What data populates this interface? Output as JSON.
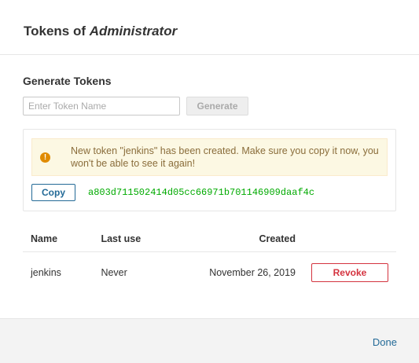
{
  "header": {
    "title_prefix": "Tokens of",
    "title_user": "Administrator"
  },
  "generate": {
    "section_title": "Generate Tokens",
    "input_placeholder": "Enter Token Name",
    "input_value": "",
    "button_label": "Generate"
  },
  "notice": {
    "message": "New token \"jenkins\" has been created. Make sure you copy it now, you won't be able to see it again!",
    "copy_label": "Copy",
    "token_value": "a803d711502414d05cc66971b701146909daaf4c",
    "alert_icon": "!"
  },
  "table": {
    "columns": {
      "name": "Name",
      "last_use": "Last use",
      "created": "Created"
    },
    "rows": [
      {
        "name": "jenkins",
        "last_use": "Never",
        "created": "November 26, 2019",
        "action": "Revoke"
      }
    ]
  },
  "footer": {
    "done_label": "Done"
  },
  "colors": {
    "accent": "#236a97",
    "danger": "#d4333f",
    "token": "#00aa00",
    "warning": "#e08b00"
  }
}
